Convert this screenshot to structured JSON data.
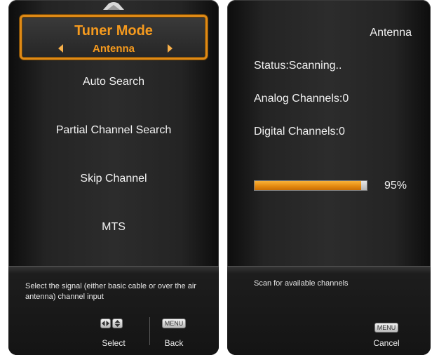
{
  "left_panel": {
    "tuner_mode": {
      "title": "Tuner Mode",
      "value": "Antenna"
    },
    "menu_items": [
      {
        "label": "Auto Search"
      },
      {
        "label": "Partial Channel Search"
      },
      {
        "label": "Skip Channel"
      },
      {
        "label": "MTS"
      }
    ],
    "help_text": "Select the signal (either basic cable or over the air antenna) channel input",
    "keys": {
      "menu_key": "MENU",
      "select_label": "Select",
      "back_label": "Back"
    }
  },
  "right_panel": {
    "source": "Antenna",
    "status": "Status:Scanning..",
    "analog": "Analog Channels:0",
    "digital": "Digital Channels:0",
    "progress": {
      "percent_label": "95%",
      "value": 0.95
    },
    "help_text": "Scan for available channels",
    "keys": {
      "menu_key": "MENU",
      "cancel_label": "Cancel"
    }
  },
  "colors": {
    "accent": "#f59a1e",
    "progress_fill": "#e58a10",
    "panel_bg": "#2c2c2c"
  }
}
